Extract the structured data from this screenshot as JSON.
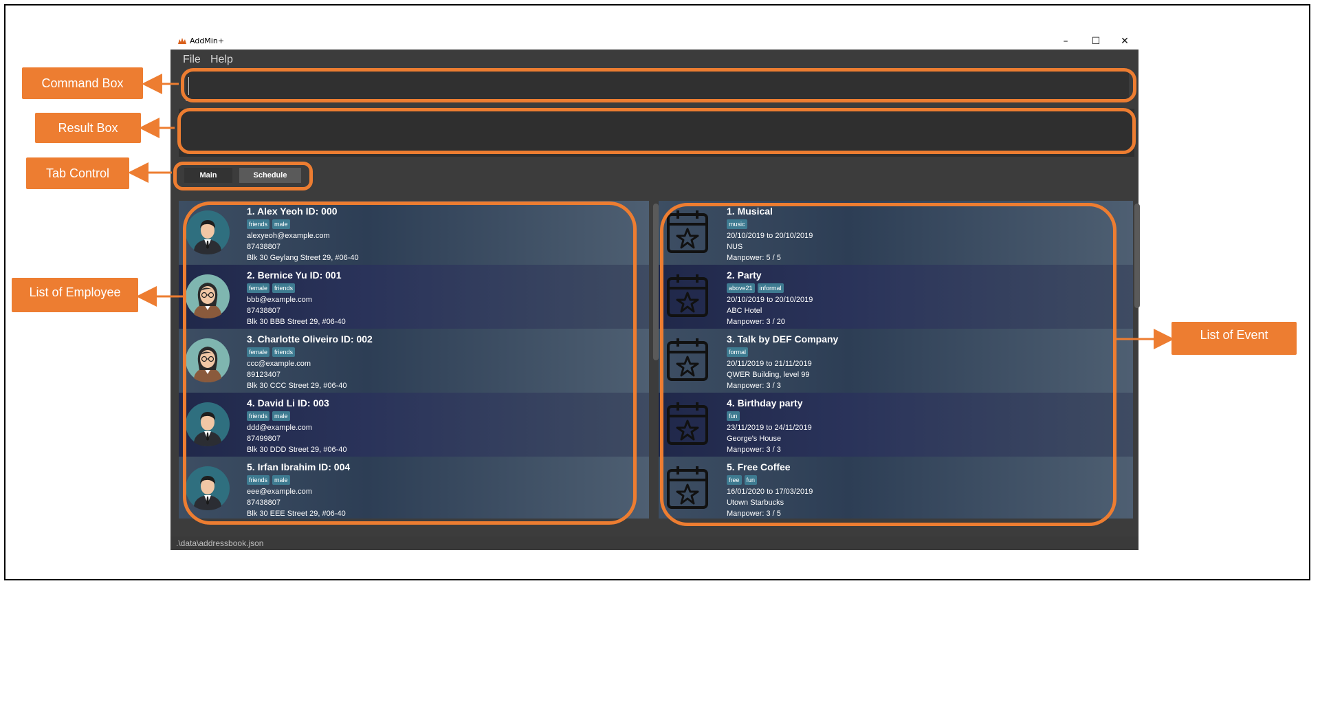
{
  "window": {
    "title": "AddMin+",
    "minimize": "–",
    "maximize": "☐",
    "close": "✕"
  },
  "menu": {
    "file": "File",
    "help": "Help"
  },
  "command_box": {
    "value": "",
    "placeholder": ""
  },
  "tabs": {
    "main": "Main",
    "schedule": "Schedule"
  },
  "employees": [
    {
      "title": "1.  Alex Yeoh ID: 000",
      "tags": [
        "friends",
        "male"
      ],
      "email": "alexyeoh@example.com",
      "phone": "87438807",
      "address": "Blk 30 Geylang Street 29, #06-40",
      "avatar": "male"
    },
    {
      "title": "2.  Bernice Yu ID: 001",
      "tags": [
        "female",
        "friends"
      ],
      "email": "bbb@example.com",
      "phone": "87438807",
      "address": "Blk 30 BBB Street 29, #06-40",
      "avatar": "female"
    },
    {
      "title": "3.  Charlotte Oliveiro ID: 002",
      "tags": [
        "female",
        "friends"
      ],
      "email": "ccc@example.com",
      "phone": "89123407",
      "address": "Blk 30 CCC Street 29, #06-40",
      "avatar": "female"
    },
    {
      "title": "4.  David Li ID: 003",
      "tags": [
        "friends",
        "male"
      ],
      "email": "ddd@example.com",
      "phone": "87499807",
      "address": "Blk 30 DDD Street 29, #06-40",
      "avatar": "male"
    },
    {
      "title": "5.  Irfan Ibrahim ID: 004",
      "tags": [
        "friends",
        "male"
      ],
      "email": "eee@example.com",
      "phone": "87438807",
      "address": "Blk 30 EEE Street 29, #06-40",
      "avatar": "male"
    }
  ],
  "events": [
    {
      "title": "1.  Musical",
      "tags": [
        "music"
      ],
      "dates": "20/10/2019 to 20/10/2019",
      "venue": "NUS",
      "manpower": "Manpower: 5 / 5"
    },
    {
      "title": "2.  Party",
      "tags": [
        "above21",
        "informal"
      ],
      "dates": "20/10/2019 to 20/10/2019",
      "venue": "ABC Hotel",
      "manpower": "Manpower: 3 / 20"
    },
    {
      "title": "3.  Talk by DEF Company",
      "tags": [
        "formal"
      ],
      "dates": "20/11/2019 to 21/11/2019",
      "venue": "QWER Building, level 99",
      "manpower": "Manpower: 3 / 3"
    },
    {
      "title": "4.  Birthday party",
      "tags": [
        "fun"
      ],
      "dates": "23/11/2019 to 24/11/2019",
      "venue": "George's House",
      "manpower": "Manpower: 3 / 3"
    },
    {
      "title": "5.  Free Coffee",
      "tags": [
        "free",
        "fun"
      ],
      "dates": "16/01/2020 to 17/03/2019",
      "venue": "Utown Starbucks",
      "manpower": "Manpower: 3 / 5"
    }
  ],
  "status": {
    "path": ".\\data\\addressbook.json"
  },
  "annotations": {
    "command_box": "Command Box",
    "result_box": "Result Box",
    "tab_control": "Tab Control",
    "employee_list": "List of Employee",
    "event_list": "List of Event"
  },
  "colors": {
    "accent": "#ed7d31",
    "tag": "#3e7b91",
    "app_bg": "#3c3c3c"
  }
}
